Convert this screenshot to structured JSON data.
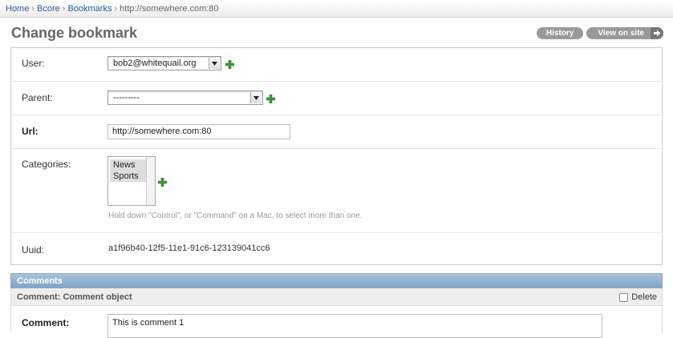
{
  "breadcrumbs": {
    "items": [
      "Home",
      "Bcore",
      "Bookmarks"
    ],
    "current": "http://somewhere.com:80",
    "separator": "›"
  },
  "page": {
    "title": "Change bookmark",
    "history_label": "History",
    "view_on_site_label": "View on site"
  },
  "form": {
    "user": {
      "label": "User:",
      "value": "bob2@whitequail.org"
    },
    "parent": {
      "label": "Parent:",
      "value": "---------"
    },
    "url": {
      "label": "Url:",
      "value": "http://somewhere.com:80"
    },
    "categories": {
      "label": "Categories:",
      "options": [
        "News",
        "Sports"
      ],
      "help": "Hold down \"Control\", or \"Command\" on a Mac, to select more than one."
    },
    "uuid": {
      "label": "Uuid:",
      "value": "a1f96b40-12f5-11e1-91c6-123139041cc6"
    }
  },
  "comments": {
    "header": "Comments",
    "item_title": "Comment: Comment object",
    "delete_label": "Delete",
    "comment_label": "Comment:",
    "comment_value": "This is comment 1"
  },
  "colors": {
    "inline_header": "#7ea4c7",
    "link": "#2a5ea0",
    "add_icon": "#3a9a2f"
  }
}
